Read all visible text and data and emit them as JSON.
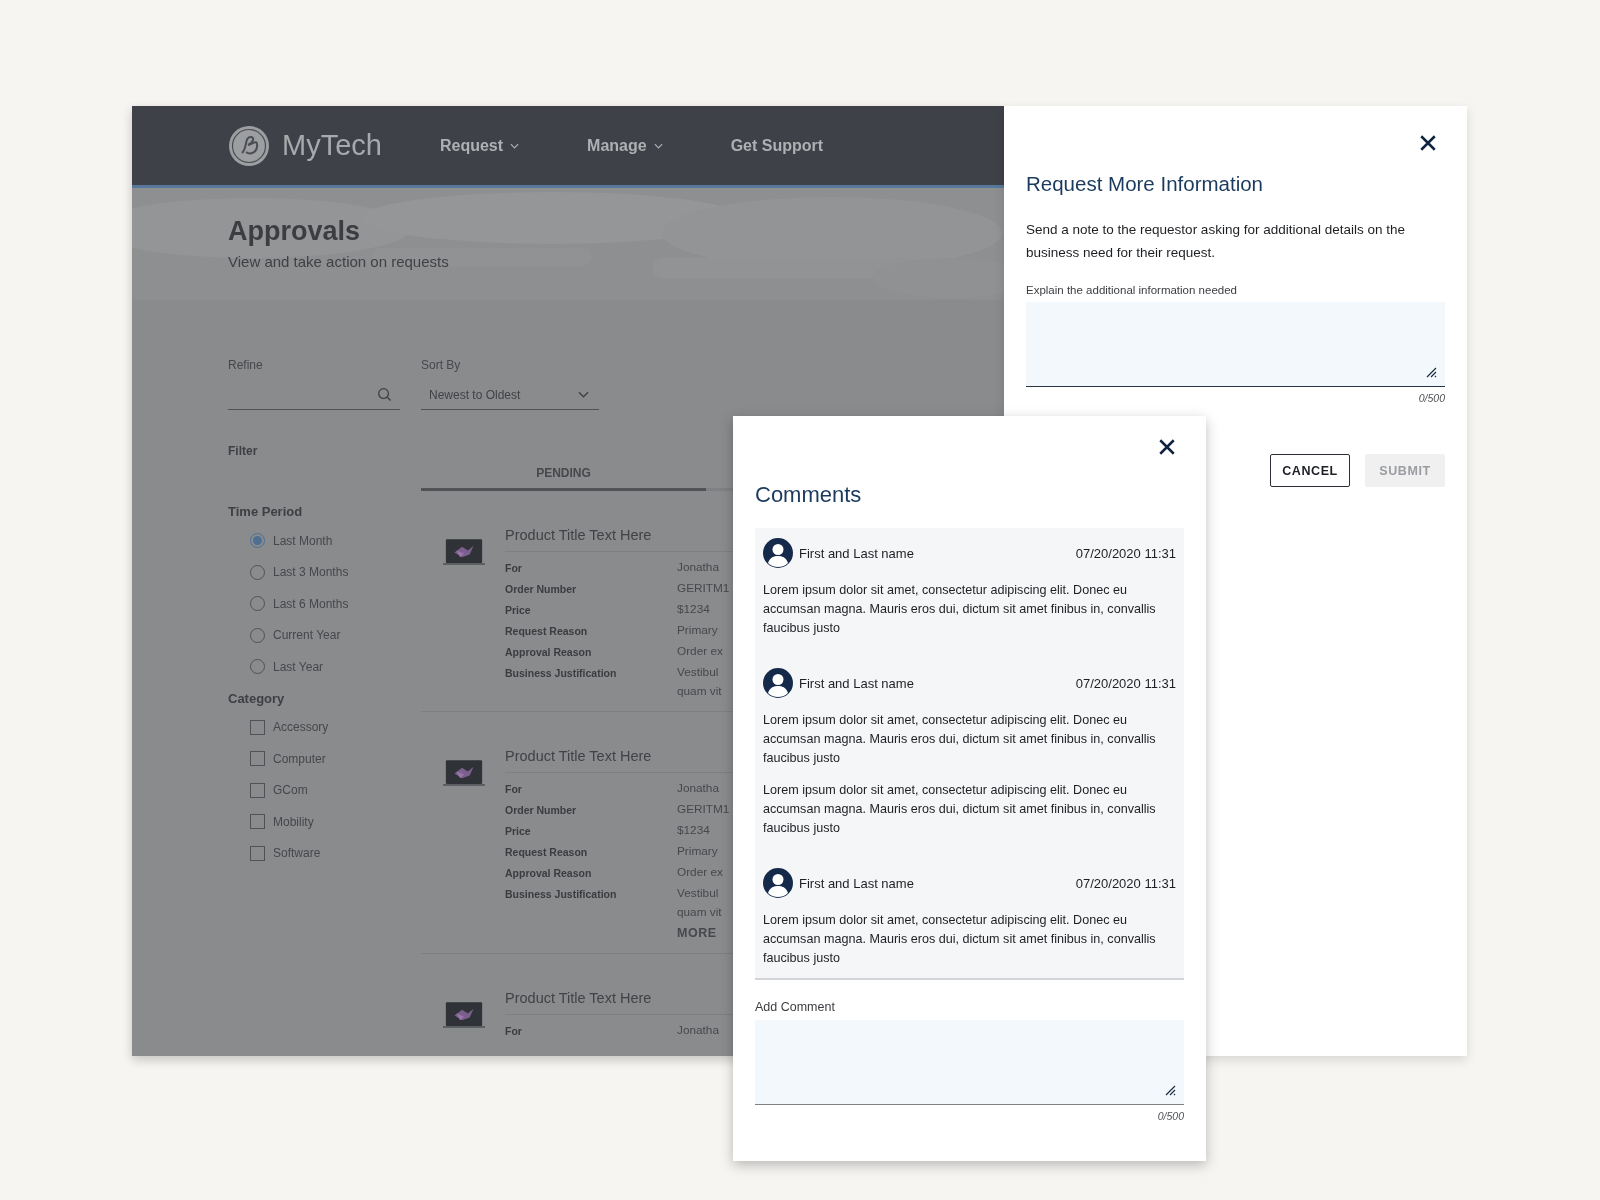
{
  "app": {
    "brand": "MyTech",
    "nav": [
      {
        "label": "Request",
        "has_menu": true
      },
      {
        "label": "Manage",
        "has_menu": true
      },
      {
        "label": "Get Support",
        "has_menu": false
      }
    ],
    "page_title": "Approvals",
    "page_subtitle": "View and take action on requests",
    "refine": {
      "label": "Refine"
    },
    "sort": {
      "label": "Sort By",
      "value": "Newest to Oldest"
    },
    "filter_heading": "Filter",
    "tabs": [
      {
        "label": "PENDING",
        "selected": true
      }
    ],
    "time_period": {
      "heading": "Time Period",
      "options": [
        {
          "label": "Last Month",
          "selected": true
        },
        {
          "label": "Last 3 Months",
          "selected": false
        },
        {
          "label": "Last 6 Months",
          "selected": false
        },
        {
          "label": "Current Year",
          "selected": false
        },
        {
          "label": "Last Year",
          "selected": false
        }
      ]
    },
    "category": {
      "heading": "Category",
      "options": [
        {
          "label": "Accessory",
          "checked": false
        },
        {
          "label": "Computer",
          "checked": false
        },
        {
          "label": "GCom",
          "checked": false
        },
        {
          "label": "Mobility",
          "checked": false
        },
        {
          "label": "Software",
          "checked": false
        }
      ]
    },
    "products": [
      {
        "title": "Product Title Text Here",
        "fields": [
          {
            "label": "For",
            "lines": [
              "Jonatha"
            ]
          },
          {
            "label": "Order Number",
            "lines": [
              "GERITM1"
            ]
          },
          {
            "label": "Price",
            "lines": [
              "$1234"
            ]
          },
          {
            "label": "Request Reason",
            "lines": [
              "Primary"
            ]
          },
          {
            "label": "Approval Reason",
            "lines": [
              "Order ex"
            ]
          },
          {
            "label": "Business Justification",
            "lines": [
              "Vestibul",
              "quam vit"
            ]
          }
        ]
      },
      {
        "title": "Product Title Text Here",
        "fields": [
          {
            "label": "For",
            "lines": [
              "Jonatha"
            ]
          },
          {
            "label": "Order Number",
            "lines": [
              "GERITM1"
            ]
          },
          {
            "label": "Price",
            "lines": [
              "$1234"
            ]
          },
          {
            "label": "Request Reason",
            "lines": [
              "Primary"
            ]
          },
          {
            "label": "Approval Reason",
            "lines": [
              "Order ex"
            ]
          },
          {
            "label": "Business Justification",
            "lines": [
              "Vestibul",
              "quam vit"
            ]
          }
        ],
        "more": "MORE"
      },
      {
        "title": "Product Title Text Here",
        "fields": [
          {
            "label": "For",
            "lines": [
              "Jonatha"
            ]
          }
        ]
      }
    ]
  },
  "request_modal": {
    "title": "Request More Information",
    "description": "Send a note to the requestor asking for additional details on the business need for their request.",
    "field_label": "Explain the additional information needed",
    "counter": "0/500",
    "buttons": [
      {
        "label": "CANCEL",
        "disabled": false
      },
      {
        "label": "SUBMIT",
        "disabled": true
      }
    ]
  },
  "comments_modal": {
    "title": "Comments",
    "comments": [
      {
        "author": "First and Last name",
        "time": "07/20/2020 11:31",
        "paragraphs": [
          "Lorem ipsum dolor sit amet, consectetur adipiscing elit. Donec eu accumsan magna. Mauris eros dui, dictum sit amet finibus in, convallis faucibus justo"
        ]
      },
      {
        "author": "First and Last name",
        "time": "07/20/2020 11:31",
        "paragraphs": [
          "Lorem ipsum dolor sit amet, consectetur adipiscing elit. Donec eu accumsan magna. Mauris eros dui, dictum sit amet finibus in, convallis faucibus justo",
          "Lorem ipsum dolor sit amet, consectetur adipiscing elit. Donec eu accumsan magna. Mauris eros dui, dictum sit amet finibus in, convallis faucibus justo"
        ]
      },
      {
        "author": "First and Last name",
        "time": "07/20/2020 11:31",
        "paragraphs": [
          "Lorem ipsum dolor sit amet, consectetur adipiscing elit. Donec eu accumsan magna. Mauris eros dui, dictum sit amet finibus in, convallis faucibus justo"
        ]
      }
    ],
    "field_label": "Add Comment",
    "counter": "0/500"
  }
}
